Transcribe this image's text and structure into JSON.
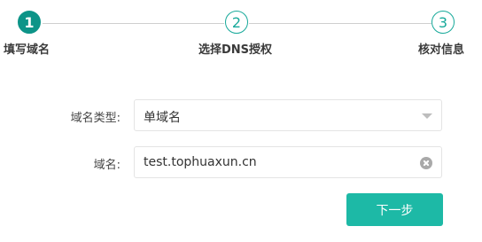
{
  "steps": [
    {
      "number": "1",
      "label": "填写域名",
      "state": "active"
    },
    {
      "number": "2",
      "label": "选择DNS授权",
      "state": "inactive"
    },
    {
      "number": "3",
      "label": "核对信息",
      "state": "inactive"
    }
  ],
  "form": {
    "domain_type": {
      "label": "域名类型:",
      "selected": "单域名"
    },
    "domain": {
      "label": "域名:",
      "value": "test.tophuaxun.cn"
    }
  },
  "actions": {
    "next_label": "下一步"
  },
  "colors": {
    "accent": "#1db9a6",
    "active_step": "#0d9488",
    "connector": "#cfcfcf"
  },
  "icons": {
    "select_caret": "chevron-down-icon",
    "clear_input": "clear-icon"
  }
}
